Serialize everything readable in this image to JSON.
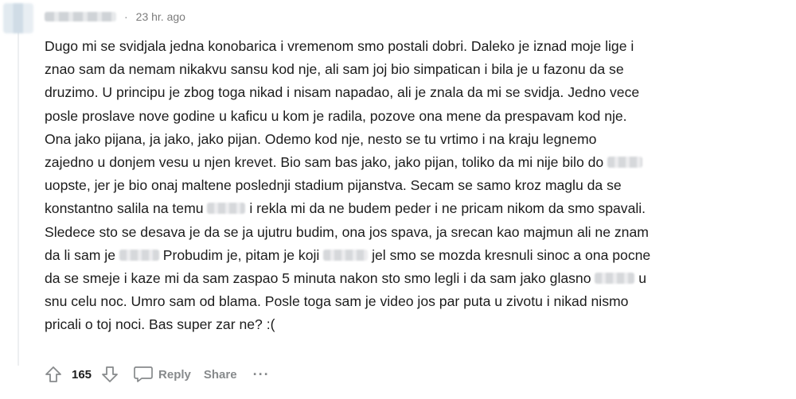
{
  "comment": {
    "timestamp": "23 hr. ago",
    "separator": "·",
    "body_lines": [
      [
        "Dugo mi se svidjala jedna konobarica i vremenom smo postali dobri. Daleko je iznad moje lige i"
      ],
      [
        "znao sam da nemam nikakvu sansu kod nje, ali sam joj bio simpatican i bila je u fazonu da se"
      ],
      [
        "druzimo. U principu je zbog toga nikad i nisam napadao, ali je znala da mi se svidja. Jedno vece"
      ],
      [
        "posle proslave nove godine u kaficu u kom je radila, pozove ona mene da prespavam kod nje."
      ],
      [
        "Ona jako pijana, ja jako, jako pijan. Odemo kod nje, nesto se tu vrtimo i na kraju legnemo"
      ],
      [
        "zajedno u donjem vesu u njen krevet. Bio sam bas jako, jako pijan, toliko da mi nije bilo do",
        ""
      ],
      [
        "uopste, jer je bio onaj maltene poslednji stadium pijanstva. Secam se samo kroz maglu da se"
      ],
      [
        "konstantno salila na temu",
        "",
        "i rekla mi da ne budem peder i ne pricam nikom da smo spavali."
      ],
      [
        "Sledece sto se desava je da se ja ujutru budim, ona jos spava, ja srecan kao majmun ali ne znam"
      ],
      [
        "da li sam je",
        "",
        "Probudim je, pitam je koji",
        "",
        "jel smo se mozda kresnuli sinoc a ona pocne"
      ],
      [
        "da se smeje i kaze mi da sam zaspao 5 minuta nakon sto smo legli i da sam jako glasno",
        "",
        "u"
      ],
      [
        "snu celu noc. Umro sam od blama. Posle toga sam je video jos par puta u zivotu i nikad nismo"
      ],
      [
        "pricali o toj noci. Bas super zar ne? :("
      ]
    ],
    "vote_count": "165",
    "reply_label": "Reply",
    "share_label": "Share",
    "more_label": "···"
  },
  "colors": {
    "text": "#1c1c1c",
    "muted": "#878a8c",
    "timestamp": "#7c7c7c",
    "thread_line": "#edeff1"
  }
}
